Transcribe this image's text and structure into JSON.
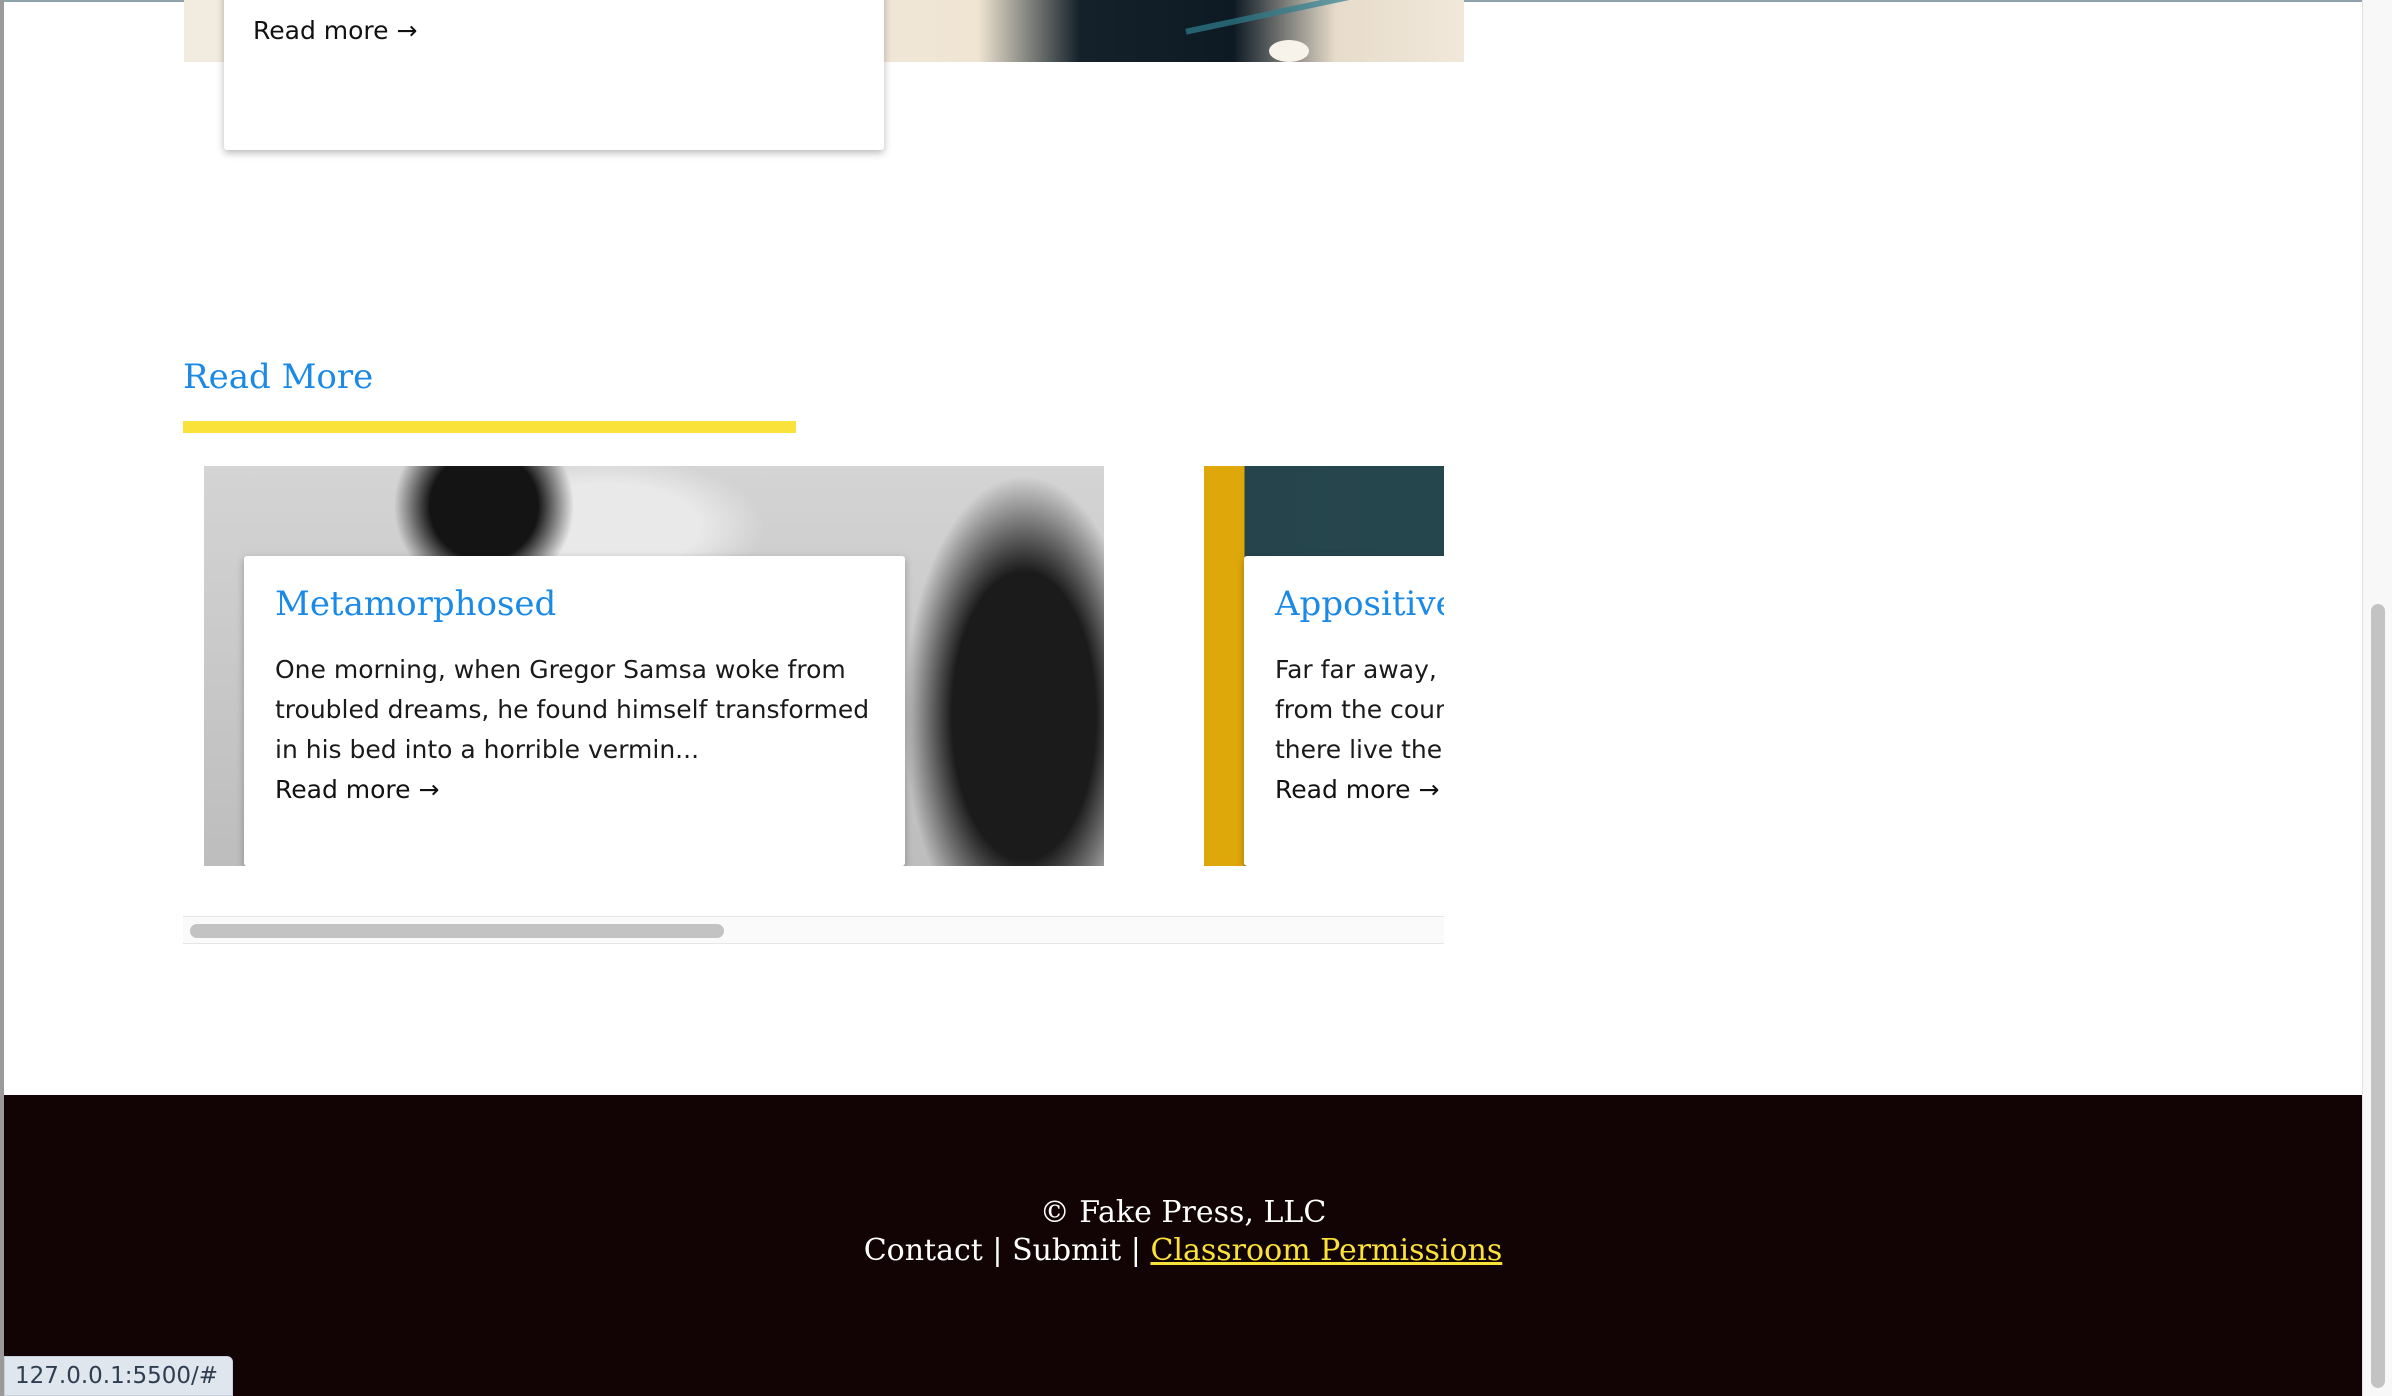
{
  "previous_card": {
    "read_more": "Read more →"
  },
  "read_more_section": {
    "title": "Read More",
    "cards": [
      {
        "title": "Metamorphosed",
        "excerpt": "One morning, when Gregor Samsa woke from troubled dreams, he found himself transformed in his bed into a horrible vermin...",
        "link": "Read more →"
      },
      {
        "title": "Appositive",
        "excerpt": "Far far away, behind the word mountains, far from the countries Vokalia and Consonantia, there live the blind texts...",
        "link": "Read more →"
      }
    ],
    "scroll_position": 0.0
  },
  "footer": {
    "copyright": "© Fake Press, LLC",
    "links": [
      "Contact",
      "Submit",
      "Classroom Permissions"
    ],
    "separator": "|",
    "highlight_color": "#fbe23a",
    "background_color": "#120404"
  },
  "status_bar": {
    "url": "127.0.0.1:5500/#"
  },
  "accent_colors": {
    "link_blue": "#1a8ae6",
    "rule_yellow": "#fbe23a"
  }
}
